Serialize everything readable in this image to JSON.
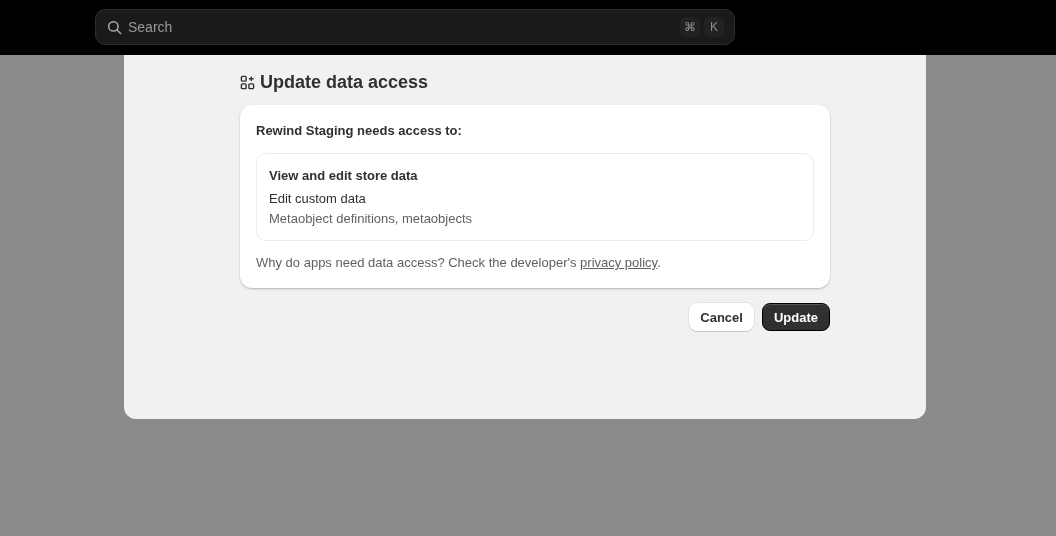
{
  "search": {
    "placeholder": "Search",
    "shortcut_keys": [
      "⌘",
      "K"
    ]
  },
  "modal": {
    "title": "Update data access",
    "card": {
      "heading": "Rewind Staging needs access to:",
      "permission": {
        "group": "View and edit store data",
        "title": "Edit custom data",
        "detail": "Metaobject definitions, metaobjects"
      },
      "note": "Why do apps need data access? Check the developer's ",
      "link": "privacy policy",
      "note_end": "."
    },
    "buttons": [
      {
        "label": "Cancel",
        "kind": "secondary"
      },
      {
        "label": "Update",
        "kind": "primary"
      }
    ]
  }
}
